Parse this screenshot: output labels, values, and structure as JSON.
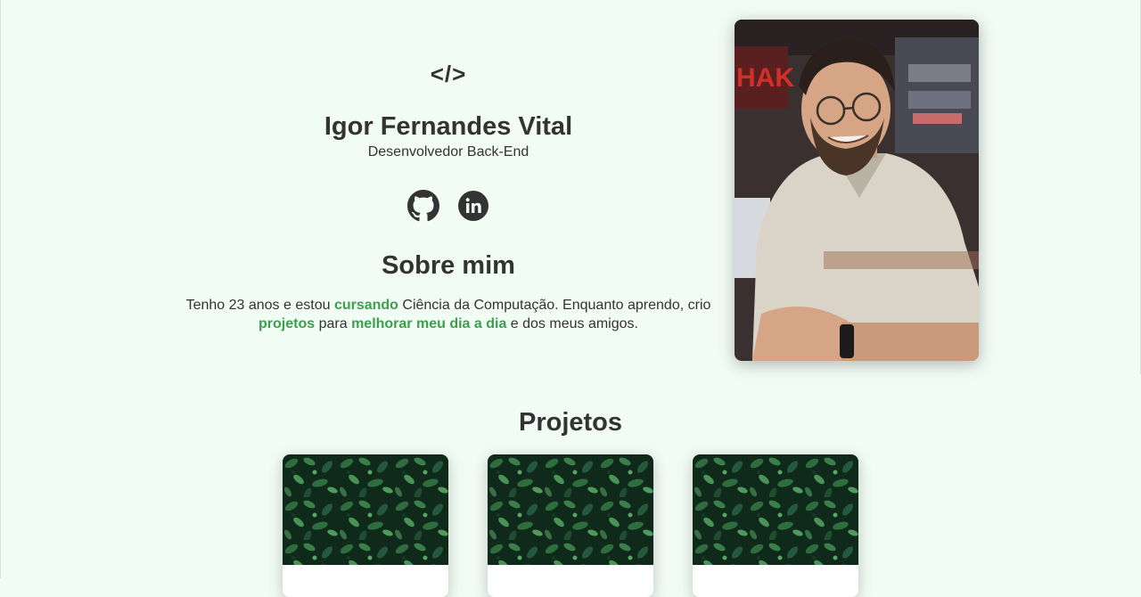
{
  "intro": {
    "logo": "</>",
    "name": "Igor Fernandes Vital",
    "role": "Desenvolvedor Back-End"
  },
  "social": [
    {
      "label": "GitHub",
      "icon": "github-icon"
    },
    {
      "label": "LinkedIn",
      "icon": "linkedin-icon"
    }
  ],
  "about": {
    "title": "Sobre mim",
    "text_1": "Tenho 23 anos e estou ",
    "highlight_1": "cursando",
    "text_2": " Ciência da Computação. Enquanto aprendo, crio ",
    "highlight_2": "projetos",
    "text_3": " para ",
    "highlight_3": "melhorar meu dia a dia",
    "text_4": " e dos meus amigos."
  },
  "profile_photo": {
    "icon": "profile-photo"
  },
  "projects": {
    "title": "Projetos",
    "cards": [
      {
        "image": "leaves-image"
      },
      {
        "image": "leaves-image"
      },
      {
        "image": "leaves-image"
      }
    ]
  },
  "colors": {
    "background": "#f1fcf4",
    "text": "#333333",
    "accent": "#3f9e4e"
  }
}
